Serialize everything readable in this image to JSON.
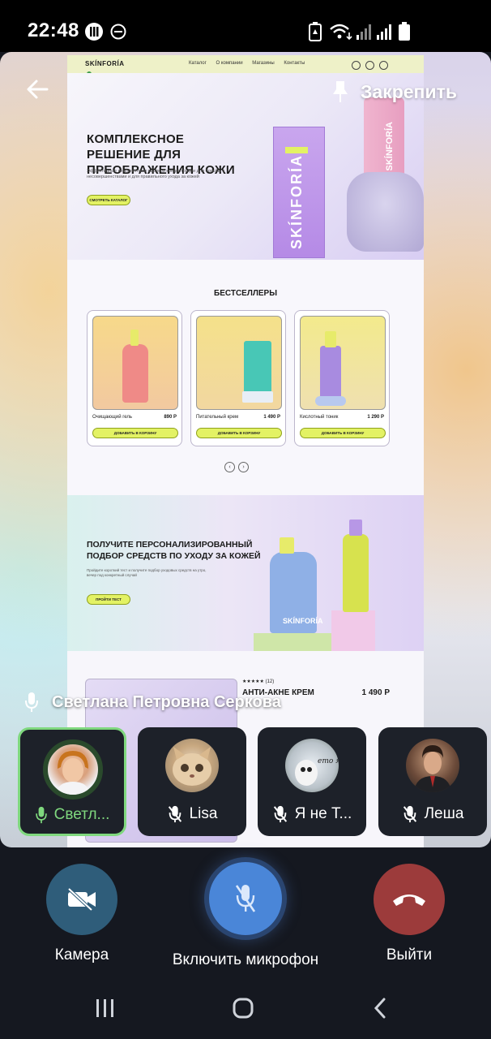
{
  "status_bar": {
    "time": "22:48",
    "icons": [
      "app-notification-icon",
      "do-not-disturb-icon",
      "battery-saver-icon",
      "wifi-icon",
      "signal-icon",
      "signal-icon-2",
      "battery-icon"
    ]
  },
  "call": {
    "pin_label": "Закрепить",
    "speaker_name": "Светлана Петровна Серкова",
    "participants": [
      {
        "label": "Светл...",
        "active": true,
        "muted": false
      },
      {
        "label": "Lisa",
        "active": false,
        "muted": true
      },
      {
        "label": "Я не Т...",
        "active": false,
        "muted": true
      },
      {
        "label": "Леша",
        "active": false,
        "muted": true
      }
    ],
    "controls": {
      "camera_label": "Камера",
      "mic_label": "Включить микрофон",
      "leave_label": "Выйти"
    },
    "colors": {
      "active_green": "#7fd87e",
      "leave_red": "#9c3b3b",
      "camera_blue": "#2f5d7a",
      "mic_blue": "#4a86d8"
    }
  },
  "shared_screen": {
    "nav": {
      "logo": "SKÍNFORÍA",
      "menu": [
        "Каталог",
        "О компании",
        "Магазины",
        "Контакты"
      ]
    },
    "hero": {
      "title": "КОМПЛЕКСНОЕ РЕШЕНИЕ ДЛЯ ПРЕОБРАЖЕНИЯ КОЖИ",
      "subtitle": "Эффективные компоненты в высокой концентрации для борьбы с несовершенствами и для правильного ухода за кожей",
      "button": "СМОТРЕТЬ КАТАЛОГ",
      "brand_box": "SKÍNFORÍA",
      "brand_tube": "SKÍNFORÍA"
    },
    "bestsellers": {
      "title": "БЕСТСЕЛЛЕРЫ",
      "cards": [
        {
          "name": "Очищающий гель",
          "price": "890 Р",
          "button": "ДОБАВИТЬ В КОРЗИНУ"
        },
        {
          "name": "Питательный крем",
          "price": "1 490 Р",
          "button": "ДОБАВИТЬ В КОРЗИНУ"
        },
        {
          "name": "Кислотный тоник",
          "price": "1 290 Р",
          "button": "ДОБАВИТЬ В КОРЗИНУ"
        }
      ]
    },
    "promo": {
      "title": "ПОЛУЧИТЕ ПЕРСОНАЛИЗИРОВАННЫЙ ПОДБОР СРЕДСТВ ПО УХОДУ ЗА КОЖЕЙ",
      "subtitle": "Пройдите короткий тест и получите подбор уходовых средств на утро, вечер под конкретный случай",
      "button": "ПРОЙТИ ТЕСТ",
      "brand": "SKÍNFORÍA"
    },
    "product": {
      "stars": "★★★★★ (12)",
      "title": "АНТИ-АКНЕ КРЕМ",
      "price": "1 490 Р"
    }
  }
}
